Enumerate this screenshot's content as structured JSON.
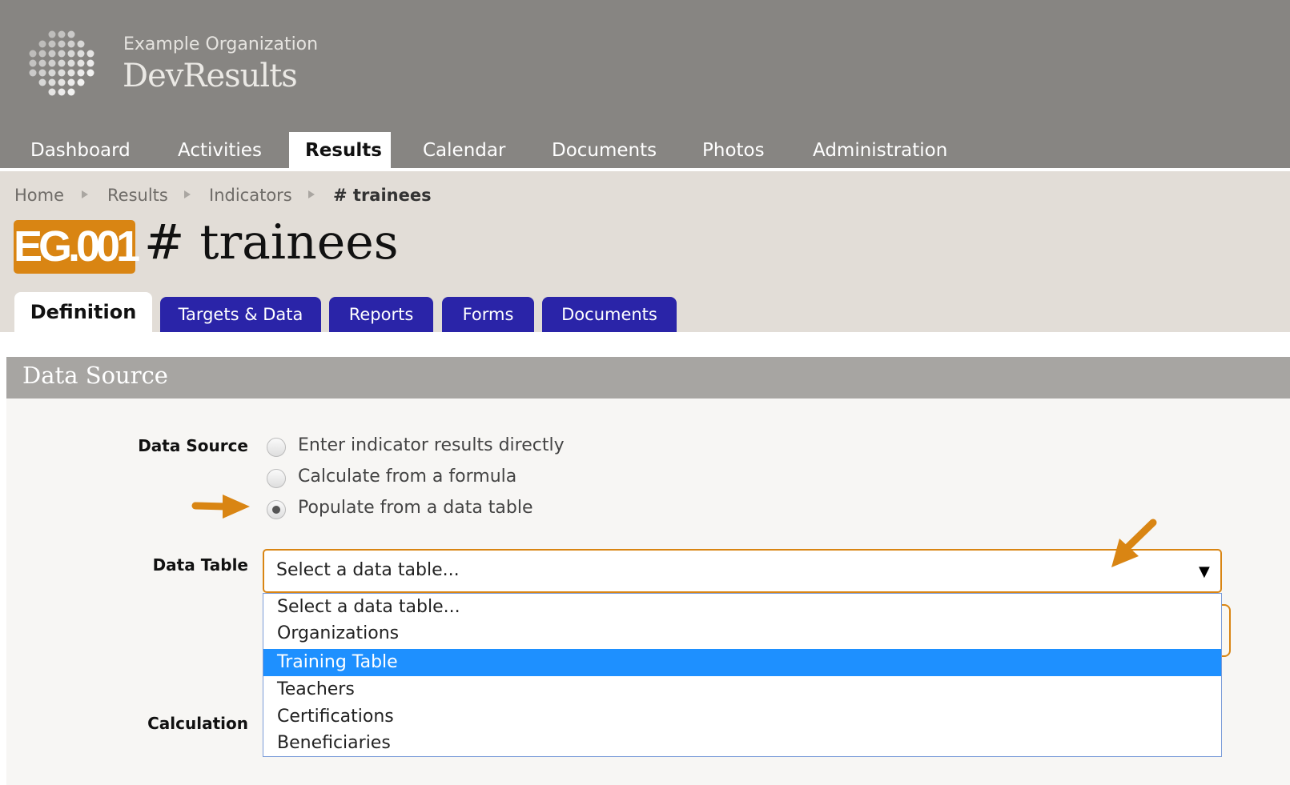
{
  "header": {
    "org_name": "Example Organization",
    "brand": "DevResults"
  },
  "nav": [
    "Dashboard",
    "Activities",
    "Results",
    "Calendar",
    "Documents",
    "Photos",
    "Administration"
  ],
  "breadcrumb": [
    "Home",
    "Results",
    "Indicators",
    "# trainees"
  ],
  "indicator": {
    "code": "EG.001",
    "title": "# trainees"
  },
  "tabs": [
    "Definition",
    "Targets & Data",
    "Reports",
    "Forms",
    "Documents"
  ],
  "section": {
    "title": "Data Source"
  },
  "form": {
    "data_source_label": "Data Source",
    "options": [
      "Enter indicator results directly",
      "Calculate from a formula",
      "Populate from a data table"
    ],
    "selected_option": "Populate from a data table",
    "data_table_label": "Data Table",
    "select_value": "Select a data table...",
    "dropdown_options": [
      "Select a data table...",
      "Organizations",
      "Training Table",
      "Teachers",
      "Certifications",
      "Beneficiaries"
    ],
    "highlighted_option": "Training Table",
    "calculation_label": "Calculation"
  },
  "colors": {
    "accent": "#d98513",
    "tab_blue": "#2a24a8",
    "highlight": "#1e90ff"
  }
}
